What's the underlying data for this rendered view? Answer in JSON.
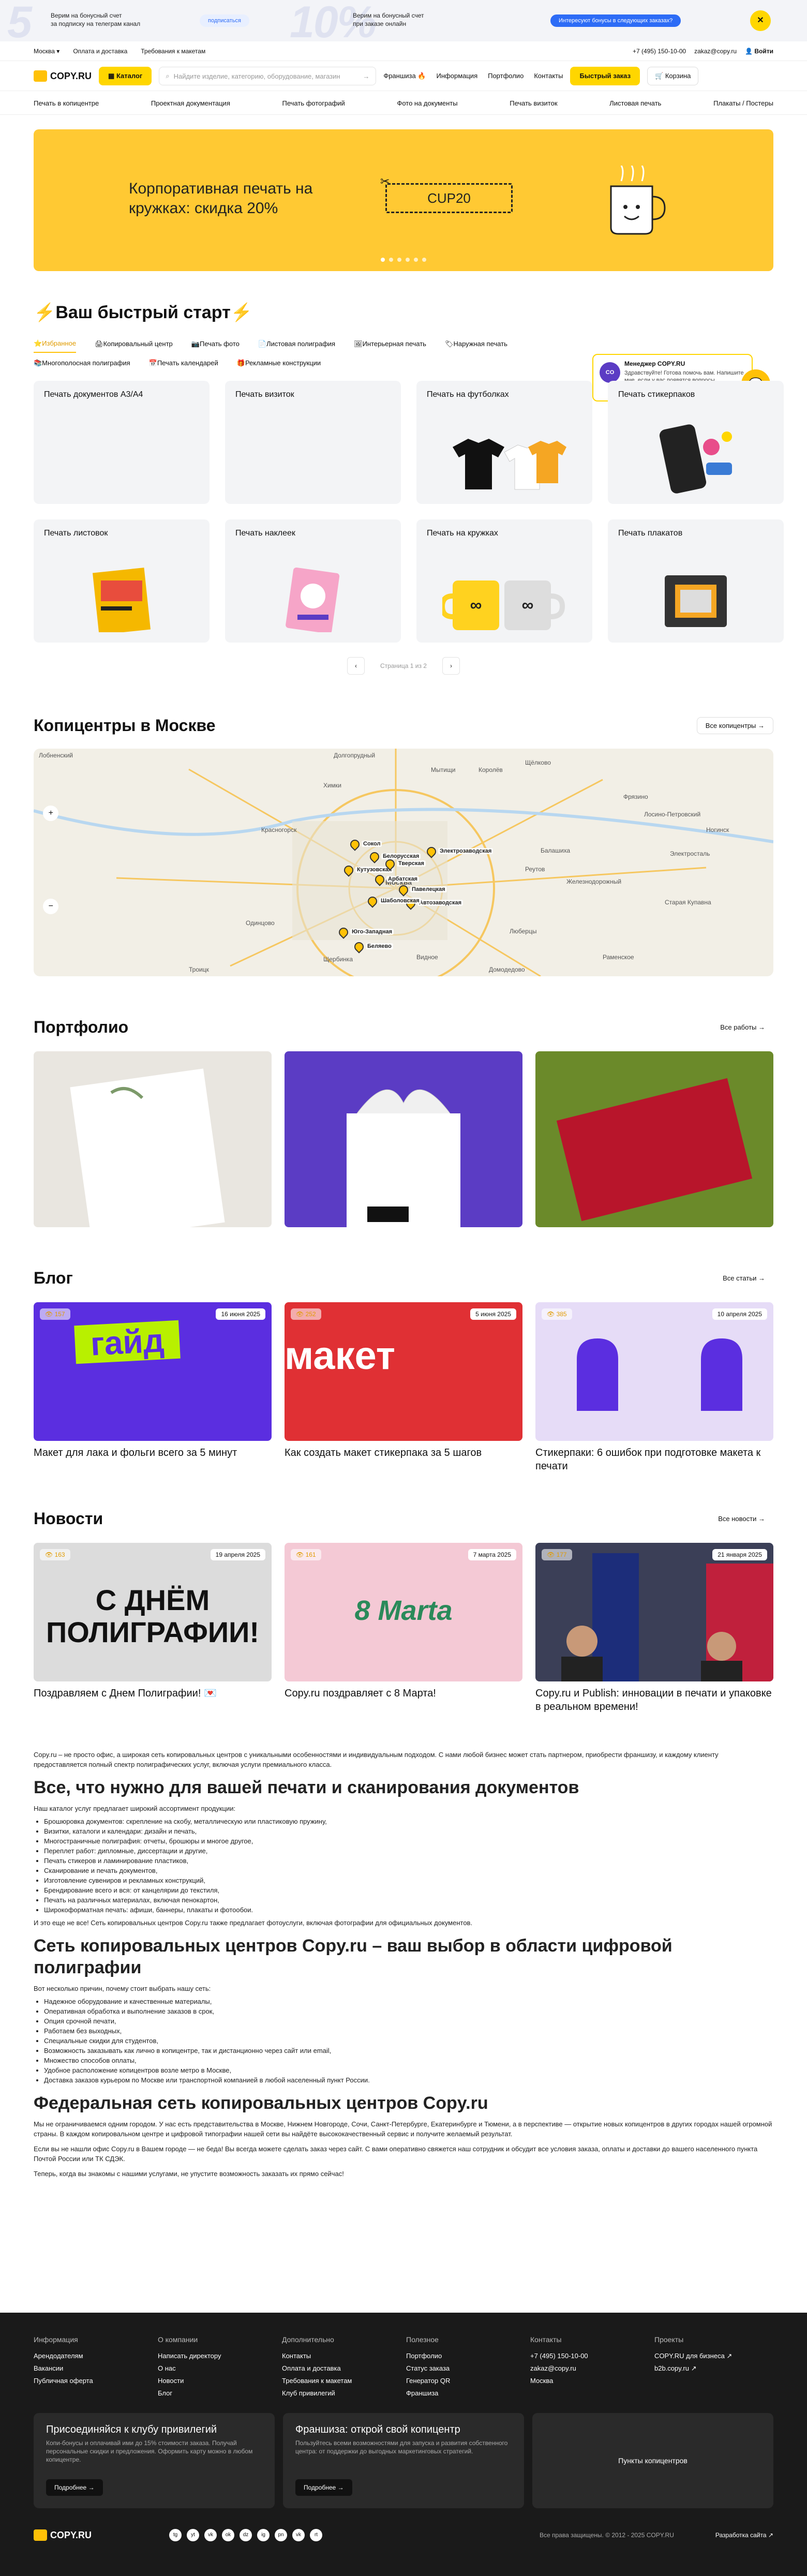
{
  "promo": {
    "big1": "5",
    "text1": "Верим на бонусный счет\nза подписку на телеграм канал",
    "btn1": "подписаться",
    "big2": "10%",
    "text2": "Верим на бонусный счет\nпри заказе онлайн",
    "btn2": "Интересуют бонусы в следующих заказах?",
    "close": "✕"
  },
  "topline": {
    "city": "Москва",
    "links": [
      "Оплата и доставка",
      "Требования к макетам"
    ],
    "phone": "+7 (495) 150-10-00",
    "email": "zakaz@copy.ru",
    "login": "Войти"
  },
  "header": {
    "logo": "COPY.RU",
    "catalog": "Каталог",
    "search_placeholder": "Найдите изделие, категорию, оборудование, магазин",
    "links": [
      "Франшиза 🔥",
      "Информация",
      "Портфолио",
      "Контакты"
    ],
    "quick": "Быстрый заказ",
    "cart": "Корзина"
  },
  "catnav": [
    "Печать в копицентре",
    "Проектная документация",
    "Печать фотографий",
    "Фото на документы",
    "Печать визиток",
    "Листовая печать",
    "Плакаты / Постеры"
  ],
  "banner": {
    "title": "Корпоративная печать на кружках: скидка 20%",
    "coupon": "CUP20"
  },
  "quick": {
    "title": "⚡Ваш быстрый старт⚡",
    "tabs": [
      "⭐Избранное",
      "🖨Копировальный центр",
      "📷Печать фото",
      "📄Листовая полиграфия",
      "🖼Интерьерная печать",
      "🏷Наружная печать",
      "📚Многополосная полиграфия",
      "📅Печать календарей",
      "🎁Рекламные конструкции"
    ],
    "manager": {
      "name": "Менеджер COPY.RU",
      "text": "Здравствуйте! Готова помочь вам. Напишите мне, если у вас появятся вопросы",
      "avatar": "CO"
    },
    "cards": [
      "Печать документов А3/А4",
      "Печать визиток",
      "Печать на футболках",
      "Печать стикерпаков",
      "Печать листовок",
      "Печать наклеек",
      "Печать на кружках",
      "Печать плакатов"
    ],
    "pager": "Страница 1 из 2"
  },
  "centers": {
    "title": "Копицентры в Москве",
    "more": "Все копицентры",
    "labels": [
      "Лобненский",
      "Долгопрудный",
      "Мытищи",
      "Королёв",
      "Щёлково",
      "Химки",
      "Лосино-Петровский",
      "Фрязино",
      "Красногорск",
      "Балашиха",
      "Реутов",
      "Электросталь",
      "Железнодорожный",
      "Старая Купавна",
      "Одинцово",
      "Люберцы",
      "Раменское",
      "Видное",
      "Щербинка",
      "Домодедово",
      "Троицк",
      "Москва",
      "Ногинск"
    ],
    "pins": [
      "Сокол",
      "Кутузовская",
      "Белорусская",
      "Тверская",
      "Арбатская",
      "Павелецкая",
      "Автозаводская",
      "Шаболовская",
      "Юго-Западная",
      "Беляево",
      "Электрозаводская"
    ]
  },
  "portfolio": {
    "title": "Портфолио",
    "more": "Все работы"
  },
  "blog": {
    "title": "Блог",
    "more": "Все статьи",
    "items": [
      {
        "title": "Макет для лака и фольги всего за 5 минут",
        "date": "16 июня 2025",
        "views": "👁 157",
        "img": "гайд"
      },
      {
        "title": "Как создать макет стикерпака за 5 шагов",
        "date": "5 июня 2025",
        "views": "👁 252",
        "img": "макет"
      },
      {
        "title": "Стикерпаки: 6 ошибок при подготовке макета к печати",
        "date": "10 апреля 2025",
        "views": "👁 385",
        "img": ""
      }
    ]
  },
  "news": {
    "title": "Новости",
    "more": "Все новости",
    "items": [
      {
        "title": "Поздравляем с Днем Полиграфии! 💌",
        "date": "19 апреля 2025",
        "views": "👁 163",
        "img": "С ДНЁМ ПОЛИГРАФИИ!"
      },
      {
        "title": "Copy.ru поздравляет с 8 Марта!",
        "date": "7 марта 2025",
        "views": "👁 161",
        "img": "8 Marta"
      },
      {
        "title": "Copy.ru и Publish: инновации в печати и упаковке в реальном времени!",
        "date": "21 января 2025",
        "views": "👁 177",
        "img": ""
      }
    ]
  },
  "seo": {
    "intro": "Copy.ru – не просто офис, а широкая сеть копировальных центров с уникальными особенностями и индивидуальным подходом. С нами любой бизнес может стать партнером, приобрести франшизу, и каждому клиенту предоставляется полный спектр полиграфических услуг, включая услуги премиального класса.",
    "h1": "Все, что нужно для вашей печати и сканирования документов",
    "p1": "Наш каталог услуг предлагает широкий ассортимент продукции:",
    "list1": [
      "Брошюровка документов: скрепление на скобу, металлическую или пластиковую пружину,",
      "Визитки, каталоги и календари: дизайн и печать,",
      "Многостраничные полиграфия: отчеты, брошюры и многое другое,",
      "Переплет работ: дипломные, диссертации и другие,",
      "Печать стикеров и ламинирование пластиков,",
      "Сканирование и печать документов,",
      "Изготовление сувениров и рекламных конструкций,",
      "Брендирование всего и вся: от канцелярии до текстиля,",
      "Печать на различных материалах, включая пенокартон,",
      "Широкоформатная печать: афиши, баннеры, плакаты и фотообои."
    ],
    "p2": "И это еще не все! Сеть копировальных центров Copy.ru также предлагает фотоуслуги, включая фотографии для официальных документов.",
    "h2": "Сеть копировальных центров Copy.ru – ваш выбор в области цифровой полиграфии",
    "p3": "Вот несколько причин, почему стоит выбрать нашу сеть:",
    "list2": [
      "Надежное оборудование и качественные материалы,",
      "Оперативная обработка и выполнение заказов в срок,",
      "Опция срочной печати,",
      "Работаем без выходных,",
      "Специальные скидки для студентов,",
      "Возможность заказывать как лично в копицентре, так и дистанционно через сайт или email,",
      "Множество способов оплаты,",
      "Удобное расположение копицентров возле метро в Москве,",
      "Доставка заказов курьером по Москве или транспортной компанией в любой населенный пункт России."
    ],
    "h3": "Федеральная сеть копировальных центров Copy.ru",
    "p4": "Мы не ограничиваемся одним городом. У нас есть представительства в Москве, Нижнем Новгороде, Сочи, Санкт-Петербурге, Екатеринбурге и Тюмени, а в перспективе — открытие новых копицентров в других городах нашей огромной страны. В каждом копировальном центре и цифровой типографии нашей сети вы найдёте высококачественный сервис и получите желаемый результат.",
    "p5": "Если вы не нашли офис Copy.ru в Вашем городе — не беда! Вы всегда можете сделать заказ через сайт. С вами оперативно свяжется наш сотрудник и обсудит все условия заказа, оплаты и доставки до вашего населенного пункта Почтой России или ТК СДЭК.",
    "p6": "Теперь, когда вы знакомы с нашими услугами, не упустите возможность заказать их прямо сейчас!"
  },
  "footer": {
    "cols": [
      {
        "h": "Информация",
        "items": [
          "Арендодателям",
          "Вакансии",
          "Публичная оферта"
        ]
      },
      {
        "h": "О компании",
        "items": [
          "Написать директору",
          "О нас",
          "Новости",
          "Блог"
        ]
      },
      {
        "h": "Дополнительно",
        "items": [
          "Контакты",
          "Оплата и доставка",
          "Требования к макетам",
          "Клуб привилегий"
        ]
      },
      {
        "h": "Полезное",
        "items": [
          "Портфолио",
          "Статус заказа",
          "Генератор QR",
          "Франшиза"
        ]
      },
      {
        "h": "Контакты",
        "items": [
          "+7 (495) 150-10-00",
          "zakaz@copy.ru",
          "Москва"
        ]
      },
      {
        "h": "Проекты",
        "items": [
          "COPY.RU для бизнеса ↗",
          "b2b.copy.ru ↗"
        ]
      }
    ],
    "club": {
      "title": "Присоединяйся к клубу привилегий",
      "text": "Копи-бонусы и оплачивай ими до 15% стоимости заказа. Получай персональные скидки и предложения. Оформить карту можно в любом копицентре.",
      "btn": "Подробнее →"
    },
    "fr": {
      "title": "Франшиза: открой свой копицентр",
      "text": "Пользуйтесь всеми возможностями для запуска и развития собственного центра: от поддержки до выгодных маркетинговых стратегий.",
      "btn": "Подробнее →"
    },
    "points": "Пункты копицентров",
    "logo": "COPY.RU",
    "copyright": "Все права защищены. © 2012 - 2025 COPY.RU",
    "dev": "Разработка сайта ↗",
    "soc": [
      "tg",
      "yt",
      "vk",
      "ok",
      "dz",
      "ig",
      "pn",
      "vk",
      "rt"
    ]
  }
}
